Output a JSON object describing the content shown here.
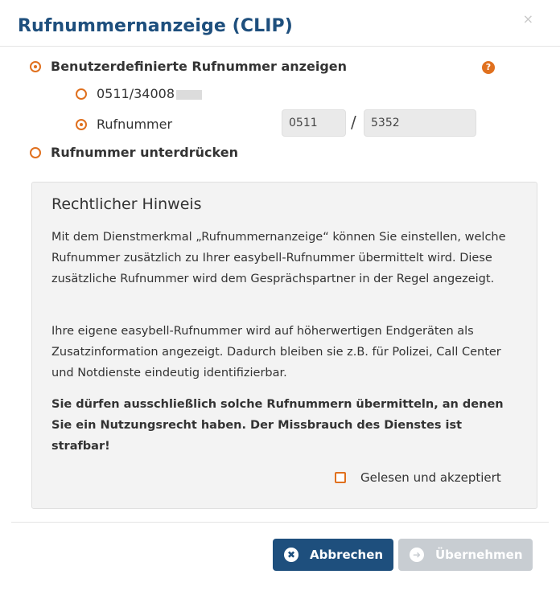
{
  "dialog": {
    "title": "Rufnummernanzeige (CLIP)",
    "close_icon": "×"
  },
  "options": {
    "custom_label": "Benutzerdefinierte Rufnummer anzeigen",
    "custom_selected": true,
    "sub_option_existing": "0511/34008",
    "sub_option_custom_label": "Rufnummer",
    "sub_option_custom_selected": true,
    "area_code_value": "0511",
    "number_value": "5352",
    "separator": "/",
    "suppress_label": "Rufnummer unterdrücken",
    "help_icon": "?"
  },
  "notice": {
    "title": "Rechtlicher Hinweis",
    "paragraph1": "Mit dem Dienstmerkmal „Rufnummernanzeige“ können Sie einstellen, welche Rufnummer zusätzlich zu Ihrer easybell-Rufnummer übermittelt wird. Diese zusätzliche Rufnummer wird dem Gesprächspartner in der Regel angezeigt.",
    "paragraph2": "Ihre eigene easybell-Rufnummer wird auf höherwertigen Endgeräten als Zusatzinformation angezeigt. Dadurch bleiben sie z.B. für Polizei, Call Center und Notdienste eindeutig identifizierbar.",
    "paragraph3": "Sie dürfen ausschließlich solche Rufnummern übermitteln, an denen Sie ein Nutzungsrecht haben. Der Missbrauch des Dienstes ist strafbar!",
    "accept_label": "Gelesen und akzeptiert",
    "accept_checked": false
  },
  "buttons": {
    "cancel_label": "Abbrechen",
    "cancel_icon": "✖",
    "apply_label": "Übernehmen",
    "apply_icon": "➜"
  },
  "colors": {
    "accent": "#e0701e",
    "brand": "#1e4f7d",
    "disabled": "#c8cdd2"
  }
}
